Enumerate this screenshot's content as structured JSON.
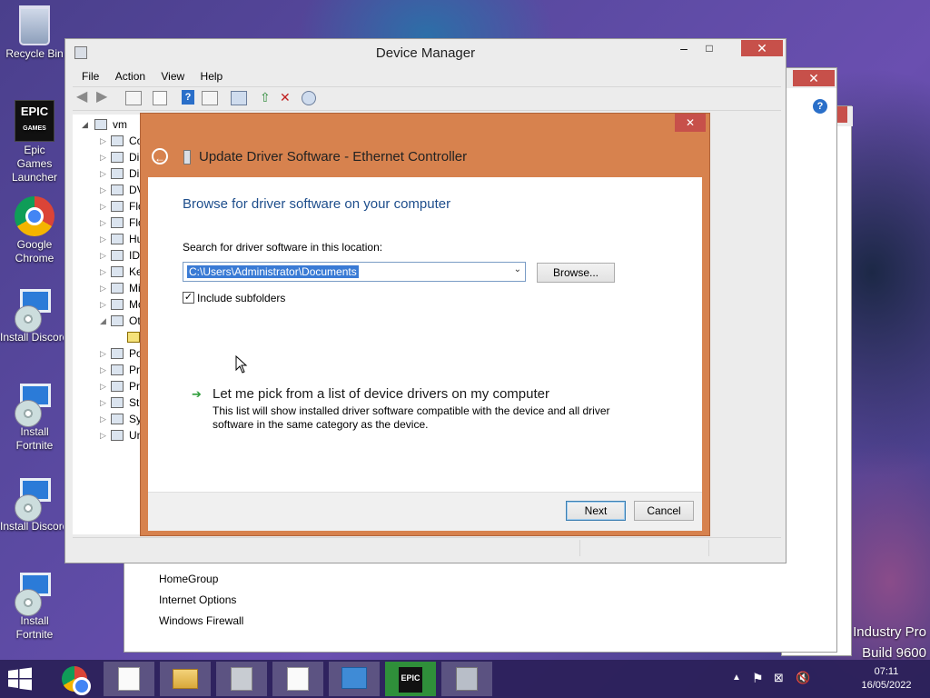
{
  "desktop": {
    "icons": [
      {
        "label": "Recycle Bin",
        "icon": "recycle-bin-icon"
      },
      {
        "label": "Epic Games Launcher",
        "icon": "epic-games-icon"
      },
      {
        "label": "Google Chrome",
        "icon": "chrome-icon"
      },
      {
        "label": "Install Discord",
        "icon": "installer-icon"
      },
      {
        "label": "Install Fortnite",
        "icon": "installer-icon"
      },
      {
        "label": "Install Discord",
        "icon": "installer-icon"
      },
      {
        "label": "Install Fortnite",
        "icon": "installer-icon"
      }
    ],
    "epic_logo_text": "EPIC",
    "epic_logo_sub": "GAMES",
    "watermark_line1": "Industry Pro",
    "watermark_line2": "Build 9600"
  },
  "background_window": {
    "links": [
      "HomeGroup",
      "Internet Options",
      "Windows Firewall"
    ]
  },
  "device_manager": {
    "title": "Device Manager",
    "menu": [
      "File",
      "Action",
      "View",
      "Help"
    ],
    "tree_root": "vm",
    "tree_items": [
      {
        "label": "Co",
        "arrow": "▷"
      },
      {
        "label": "Di",
        "arrow": "▷"
      },
      {
        "label": "Di",
        "arrow": "▷"
      },
      {
        "label": "DV",
        "arrow": "▷"
      },
      {
        "label": "Flo",
        "arrow": "▷"
      },
      {
        "label": "Flo",
        "arrow": "▷"
      },
      {
        "label": "Hu",
        "arrow": "▷"
      },
      {
        "label": "IDI",
        "arrow": "▷"
      },
      {
        "label": "Ke",
        "arrow": "▷"
      },
      {
        "label": "Mi",
        "arrow": "▷"
      },
      {
        "label": "Mo",
        "arrow": "▷"
      },
      {
        "label": "Ot",
        "arrow": "◢"
      },
      {
        "label": "",
        "arrow": ""
      },
      {
        "label": "Po",
        "arrow": "▷"
      },
      {
        "label": "Pri",
        "arrow": "▷"
      },
      {
        "label": "Pro",
        "arrow": "▷"
      },
      {
        "label": "Sto",
        "arrow": "▷"
      },
      {
        "label": "Sy",
        "arrow": "▷"
      },
      {
        "label": "Un",
        "arrow": "▷"
      }
    ]
  },
  "dialog": {
    "title": "Update Driver Software - Ethernet Controller",
    "heading": "Browse for driver software on your computer",
    "search_label": "Search for driver software in this location:",
    "path_value": "C:\\Users\\Administrator\\Documents",
    "browse_label": "Browse...",
    "include_subfolders_label": "Include subfolders",
    "include_subfolders_checked": true,
    "pick_title": "Let me pick from a list of device drivers on my computer",
    "pick_desc_line1": "This list will show installed driver software compatible with the device and all driver",
    "pick_desc_line2": "software in the same category as the device.",
    "next_label": "Next",
    "cancel_label": "Cancel",
    "close_glyph": "✕",
    "back_glyph": "←",
    "pick_arrow_glyph": "➔"
  },
  "taskbar": {
    "time": "07:11",
    "date": "16/05/2022",
    "epic_text": "EPIC"
  },
  "colors": {
    "dialog_frame": "#d7824e",
    "heading_blue": "#1e4e8c",
    "close_red": "#c7504a"
  }
}
